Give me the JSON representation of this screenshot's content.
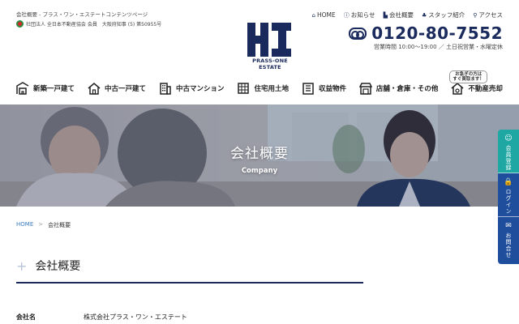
{
  "header": {
    "tagline": "会社概要 - プラス・ワン・エステートコンテンツページ",
    "association": "社団法人 全日本不動産協会 会員　大阪府知事 (5) 第50955号",
    "logo_text_line1": "PRASS-ONE",
    "logo_text_line2": "ESTATE",
    "topnav": [
      {
        "icon": "home-icon",
        "glyph": "⌂",
        "label": "HOME"
      },
      {
        "icon": "info-icon",
        "glyph": "ⓘ",
        "label": "お知らせ"
      },
      {
        "icon": "building-icon",
        "glyph": "▙",
        "label": "会社概要"
      },
      {
        "icon": "staff-icon",
        "glyph": "♣",
        "label": "スタッフ紹介"
      },
      {
        "icon": "pin-icon",
        "glyph": "⚲",
        "label": "アクセス"
      }
    ],
    "phone": "0120-80-7552",
    "hours": "営業時間 10:00～19:00 ／ 土日祝営業・水曜定休"
  },
  "mainnav": {
    "items": [
      {
        "label": "新築一戸建て",
        "icon": "new-house-icon"
      },
      {
        "label": "中古一戸建て",
        "icon": "used-house-icon"
      },
      {
        "label": "中古マンション",
        "icon": "apartment-icon"
      },
      {
        "label": "住宅用土地",
        "icon": "land-icon"
      },
      {
        "label": "収益物件",
        "icon": "income-property-icon"
      },
      {
        "label": "店舗・倉庫・その他",
        "icon": "store-icon"
      },
      {
        "label": "不動産売却",
        "icon": "sell-icon"
      }
    ],
    "sell_bubble_line1": "お急ぎの方は",
    "sell_bubble_line2": "すぐ買取ます！"
  },
  "hero": {
    "title": "会社概要",
    "subtitle": "Company"
  },
  "breadcrumb": {
    "home": "HOME",
    "separator": ">",
    "current": "会社概要"
  },
  "section": {
    "plus": "+",
    "title": "会社概要"
  },
  "company_table": [
    {
      "label": "会社名",
      "value": "株式会社プラス・ワン・エステート"
    }
  ],
  "sidetabs": [
    {
      "label": "会員登録",
      "glyph": "☺"
    },
    {
      "label": "ログイン",
      "glyph": "🔒"
    },
    {
      "label": "お問合せ",
      "glyph": "✉"
    }
  ],
  "colors": {
    "navy": "#1a2a5c",
    "teal": "#1fa7a3",
    "blue": "#1f4e9c",
    "link": "#3a7bbf"
  }
}
